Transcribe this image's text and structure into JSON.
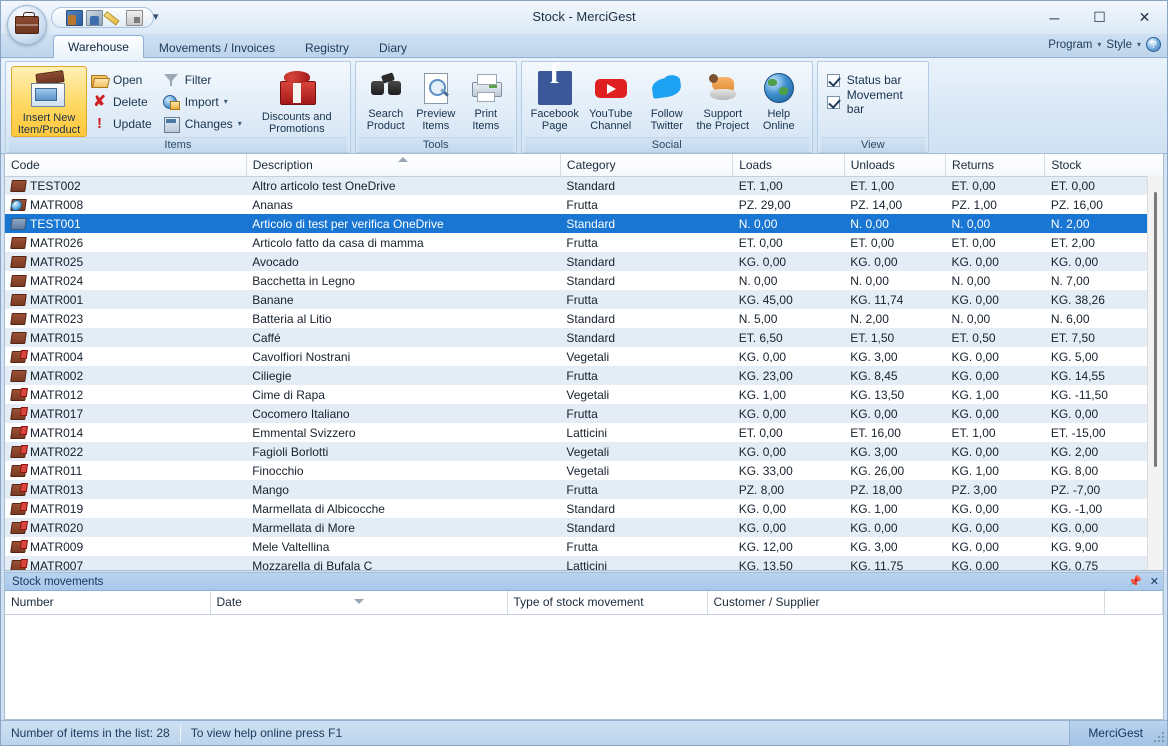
{
  "window": {
    "title": "Stock - MerciGest",
    "app_icon": "briefcase-icon",
    "minimize": "─",
    "maximize": "☐",
    "close": "✕"
  },
  "quick_access": [
    {
      "name": "customers-icon",
      "label": ""
    },
    {
      "name": "suppliers-icon",
      "label": ""
    },
    {
      "name": "edit-pencil-icon",
      "label": ""
    },
    {
      "name": "window-icon",
      "label": ""
    }
  ],
  "tabs": [
    {
      "label": "Warehouse",
      "active": true
    },
    {
      "label": "Movements / Invoices",
      "active": false
    },
    {
      "label": "Registry",
      "active": false
    },
    {
      "label": "Diary",
      "active": false
    }
  ],
  "tabbar_right": {
    "program": "Program",
    "style": "Style",
    "help": "?"
  },
  "ribbon": {
    "groups": [
      {
        "title": "Items",
        "big_button": {
          "label_line1": "Insert New",
          "label_line2": "Item/Product",
          "icon": "insert-item-icon"
        },
        "small_buttons": [
          {
            "label": "Open",
            "icon": "open-folder-icon",
            "dropdown": false
          },
          {
            "label": "Delete",
            "icon": "delete-x-icon",
            "dropdown": false
          },
          {
            "label": "Update",
            "icon": "update-icon",
            "dropdown": false
          },
          {
            "label": "Filter",
            "icon": "filter-icon",
            "dropdown": false
          },
          {
            "label": "Import",
            "icon": "import-icon",
            "dropdown": true
          },
          {
            "label": "Changes",
            "icon": "changes-icon",
            "dropdown": true
          }
        ],
        "promo_button": {
          "label_line1": "Discounts and",
          "label_line2": "Promotions",
          "icon": "gift-icon"
        }
      },
      {
        "title": "Tools",
        "buttons": [
          {
            "label_line1": "Search",
            "label_line2": "Product",
            "icon": "binoculars-icon"
          },
          {
            "label_line1": "Preview",
            "label_line2": "Items",
            "icon": "preview-icon"
          },
          {
            "label_line1": "Print",
            "label_line2": "Items",
            "icon": "printer-icon"
          }
        ]
      },
      {
        "title": "Social",
        "buttons": [
          {
            "label_line1": "Facebook",
            "label_line2": "Page",
            "icon": "facebook-icon"
          },
          {
            "label_line1": "YouTube",
            "label_line2": "Channel",
            "icon": "youtube-icon"
          },
          {
            "label_line1": "Follow",
            "label_line2": "Twitter",
            "icon": "twitter-icon"
          },
          {
            "label_line1": "Support",
            "label_line2": "the Project",
            "icon": "support-icon"
          },
          {
            "label_line1": "Help",
            "label_line2": "Online",
            "icon": "globe-icon"
          }
        ]
      },
      {
        "title": "View",
        "checkboxes": [
          {
            "label": "Status bar",
            "checked": true
          },
          {
            "label": "Movement bar",
            "checked": true
          }
        ]
      }
    ]
  },
  "grid": {
    "columns": [
      "Code",
      "Description",
      "Category",
      "Loads",
      "Unloads",
      "Returns",
      "Stock"
    ],
    "sorted_column": "Description",
    "sort_direction": "asc",
    "rows": [
      {
        "icon": "book-icon",
        "code": "TEST002",
        "description": "Altro articolo test OneDrive",
        "category": "Standard",
        "loads": "ET. 1,00",
        "unloads": "ET. 1,00",
        "returns": "ET. 0,00",
        "stock": "ET. 0,00",
        "selected": false
      },
      {
        "icon": "book-clock-icon",
        "code": "MATR008",
        "description": "Ananas",
        "category": "Frutta",
        "loads": "PZ. 29,00",
        "unloads": "PZ. 14,00",
        "returns": "PZ. 1,00",
        "stock": "PZ. 16,00",
        "selected": false
      },
      {
        "icon": "book-blue-icon",
        "code": "TEST001",
        "description": "Articolo di test per verifica OneDrive",
        "category": "Standard",
        "loads": "N. 0,00",
        "unloads": "N. 0,00",
        "returns": "N. 0,00",
        "stock": "N. 2,00",
        "selected": true
      },
      {
        "icon": "book-icon",
        "code": "MATR026",
        "description": "Articolo fatto da casa di mamma",
        "category": "Frutta",
        "loads": "ET. 0,00",
        "unloads": "ET. 0,00",
        "returns": "ET. 0,00",
        "stock": "ET. 2,00",
        "selected": false
      },
      {
        "icon": "book-icon",
        "code": "MATR025",
        "description": "Avocado",
        "category": "Standard",
        "loads": "KG. 0,00",
        "unloads": "KG. 0,00",
        "returns": "KG. 0,00",
        "stock": "KG. 0,00",
        "selected": false
      },
      {
        "icon": "book-icon",
        "code": "MATR024",
        "description": "Bacchetta in Legno",
        "category": "Standard",
        "loads": "N. 0,00",
        "unloads": "N. 0,00",
        "returns": "N. 0,00",
        "stock": "N. 7,00",
        "selected": false
      },
      {
        "icon": "book-icon",
        "code": "MATR001",
        "description": "Banane",
        "category": "Frutta",
        "loads": "KG. 45,00",
        "unloads": "KG. 11,74",
        "returns": "KG. 0,00",
        "stock": "KG. 38,26",
        "selected": false
      },
      {
        "icon": "book-icon",
        "code": "MATR023",
        "description": "Batteria al Litio",
        "category": "Standard",
        "loads": "N. 5,00",
        "unloads": "N. 2,00",
        "returns": "N. 0,00",
        "stock": "N. 6,00",
        "selected": false
      },
      {
        "icon": "book-icon",
        "code": "MATR015",
        "description": "Caffé",
        "category": "Standard",
        "loads": "ET. 6,50",
        "unloads": "ET. 1,50",
        "returns": "ET. 0,50",
        "stock": "ET. 7,50",
        "selected": false
      },
      {
        "icon": "book-tag-icon",
        "code": "MATR004",
        "description": "Cavolfiori Nostrani",
        "category": "Vegetali",
        "loads": "KG. 0,00",
        "unloads": "KG. 3,00",
        "returns": "KG. 0,00",
        "stock": "KG. 5,00",
        "selected": false
      },
      {
        "icon": "book-icon",
        "code": "MATR002",
        "description": "Ciliegie",
        "category": "Frutta",
        "loads": "KG. 23,00",
        "unloads": "KG. 8,45",
        "returns": "KG. 0,00",
        "stock": "KG. 14,55",
        "selected": false
      },
      {
        "icon": "book-tag-icon",
        "code": "MATR012",
        "description": "Cime di Rapa",
        "category": "Vegetali",
        "loads": "KG. 1,00",
        "unloads": "KG. 13,50",
        "returns": "KG. 1,00",
        "stock": "KG. -11,50",
        "selected": false
      },
      {
        "icon": "book-tag-icon",
        "code": "MATR017",
        "description": "Cocomero Italiano",
        "category": "Frutta",
        "loads": "KG. 0,00",
        "unloads": "KG. 0,00",
        "returns": "KG. 0,00",
        "stock": "KG. 0,00",
        "selected": false
      },
      {
        "icon": "book-tag-icon",
        "code": "MATR014",
        "description": "Emmental Svizzero",
        "category": "Latticini",
        "loads": "ET. 0,00",
        "unloads": "ET. 16,00",
        "returns": "ET. 1,00",
        "stock": "ET. -15,00",
        "selected": false
      },
      {
        "icon": "book-tag-icon",
        "code": "MATR022",
        "description": "Fagioli Borlotti",
        "category": "Vegetali",
        "loads": "KG. 0,00",
        "unloads": "KG. 3,00",
        "returns": "KG. 0,00",
        "stock": "KG. 2,00",
        "selected": false
      },
      {
        "icon": "book-tag-icon",
        "code": "MATR011",
        "description": "Finocchio",
        "category": "Vegetali",
        "loads": "KG. 33,00",
        "unloads": "KG. 26,00",
        "returns": "KG. 1,00",
        "stock": "KG. 8,00",
        "selected": false
      },
      {
        "icon": "book-tag-icon",
        "code": "MATR013",
        "description": "Mango",
        "category": "Frutta",
        "loads": "PZ. 8,00",
        "unloads": "PZ. 18,00",
        "returns": "PZ. 3,00",
        "stock": "PZ. -7,00",
        "selected": false
      },
      {
        "icon": "book-tag-icon",
        "code": "MATR019",
        "description": "Marmellata di Albicocche",
        "category": "Standard",
        "loads": "KG. 0,00",
        "unloads": "KG. 1,00",
        "returns": "KG. 0,00",
        "stock": "KG. -1,00",
        "selected": false
      },
      {
        "icon": "book-tag-icon",
        "code": "MATR020",
        "description": "Marmellata di More",
        "category": "Standard",
        "loads": "KG. 0,00",
        "unloads": "KG. 0,00",
        "returns": "KG. 0,00",
        "stock": "KG. 0,00",
        "selected": false
      },
      {
        "icon": "book-tag-icon",
        "code": "MATR009",
        "description": "Mele Valtellina",
        "category": "Frutta",
        "loads": "KG. 12,00",
        "unloads": "KG. 3,00",
        "returns": "KG. 0,00",
        "stock": "KG. 9,00",
        "selected": false
      },
      {
        "icon": "book-tag-icon",
        "code": "MATR007",
        "description": "Mozzarella di Bufala C",
        "category": "Latticini",
        "loads": "KG. 13,50",
        "unloads": "KG. 11,75",
        "returns": "KG. 0,00",
        "stock": "KG. 0,75",
        "selected": false
      }
    ]
  },
  "dock_panel": {
    "title": "Stock movements",
    "pin_icon": "pin-icon",
    "close_icon": "close-icon",
    "columns": [
      "Number",
      "Date",
      "Type of stock movement",
      "Customer / Supplier"
    ],
    "sorted_column": "Date",
    "rows": []
  },
  "statusbar": {
    "items_count": "Number of items in the list: 28",
    "help_hint": "To view help online press F1",
    "brand": "MerciGest"
  },
  "colors": {
    "selection_blue": "#1976d2",
    "alt_row": "#e4edf6",
    "chrome_blue": "#cfe0f2",
    "accent_gold": "#ffd862"
  }
}
